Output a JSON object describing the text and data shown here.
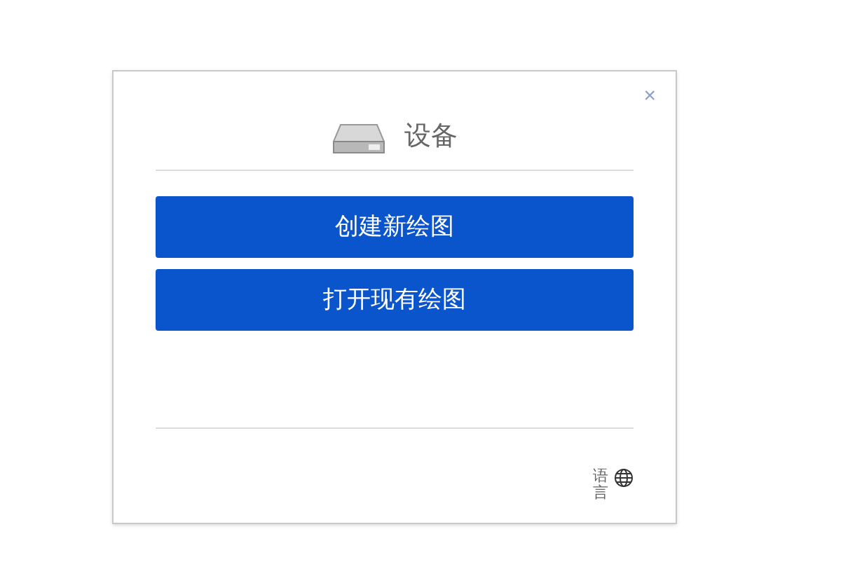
{
  "dialog": {
    "close": "×",
    "title": "设备"
  },
  "buttons": [
    "创建新绘图",
    "打开现有绘图"
  ],
  "footer": {
    "language": "语言"
  }
}
